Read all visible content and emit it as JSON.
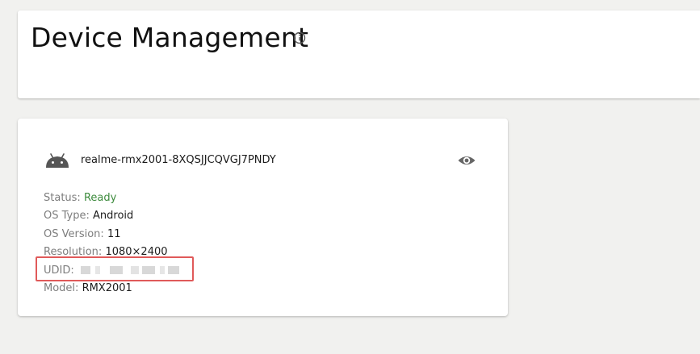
{
  "header": {
    "title": "Device Management",
    "info_icon": "info-circle-icon"
  },
  "device": {
    "os_icon": "android-icon",
    "name": "realme-rmx2001-8XQSJJCQVGJ7PNDY",
    "view_icon": "eye-icon",
    "properties": [
      {
        "label": "Status:",
        "value": "Ready"
      },
      {
        "label": "OS Type:",
        "value": "Android"
      },
      {
        "label": "OS Version:",
        "value": "11"
      },
      {
        "label": "Resolution:",
        "value": "1080×2400"
      },
      {
        "label": "UDID:",
        "value": ""
      },
      {
        "label": "Model:",
        "value": "RMX2001"
      }
    ]
  },
  "colors": {
    "status_ready": "#3d8b3d",
    "highlight": "#e05a5a"
  }
}
